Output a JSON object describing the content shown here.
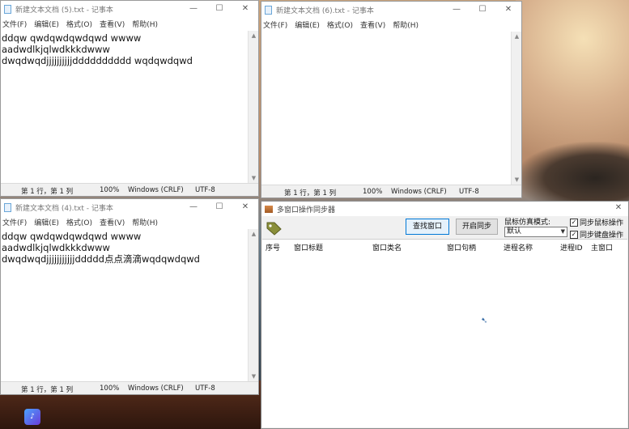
{
  "desktop": {
    "bg_top": "#caa27a",
    "bg_bottom": "#1e2b36"
  },
  "notepad_menu": [
    "文件(F)",
    "编辑(E)",
    "格式(O)",
    "查看(V)",
    "帮助(H)"
  ],
  "window_buttons": {
    "minimize": "—",
    "maximize": "☐",
    "close": "✕"
  },
  "notepad5": {
    "title": "新建文本文档 (5).txt - 记事本",
    "lines": [
      "ddqw qwdqwdqwdqwd wwww",
      "",
      "aadwdlkjqlwdkkkdwww",
      "dwqdwqdjjjjjjjjjjdddddddddd wqdqwdqwd"
    ],
    "status": {
      "position": "第 1 行，第 1 列",
      "zoom": "100%",
      "eol": "Windows (CRLF)",
      "encoding": "UTF-8"
    }
  },
  "notepad6": {
    "title": "新建文本文档 (6).txt - 记事本",
    "lines": [],
    "status": {
      "position": "第 1 行，第 1 列",
      "zoom": "100%",
      "eol": "Windows (CRLF)",
      "encoding": "UTF-8"
    }
  },
  "notepad4": {
    "title": "新建文本文档 (4).txt - 记事本",
    "lines": [
      "ddqw qwdqwdqwdqwd wwww",
      "",
      "aadwdlkjqlwdkkkdwww",
      "dwqdwqdjjjjjjjjjjjddddd点点滴滴wqdqwdqwd"
    ],
    "status": {
      "position": "第 1 行，第 1 列",
      "zoom": "100%",
      "eol": "Windows (CRLF)",
      "encoding": "UTF-8"
    }
  },
  "sync": {
    "title": "多窗口操作同步器",
    "find_button": "查找窗口",
    "start_button": "开启同步",
    "mouse_mode_label": "鼠标仿真模式:",
    "mouse_mode_value": "默认",
    "sync_mouse_label": "同步鼠标操作",
    "sync_mouse_checked": true,
    "sync_keyboard_label": "同步键盘操作",
    "sync_keyboard_checked": true,
    "columns": [
      "序号",
      "窗口标题",
      "窗口类名",
      "窗口句柄",
      "进程名称",
      "进程ID",
      "主窗口"
    ]
  },
  "taskbar": {
    "icon": "app-shortcut-icon"
  }
}
